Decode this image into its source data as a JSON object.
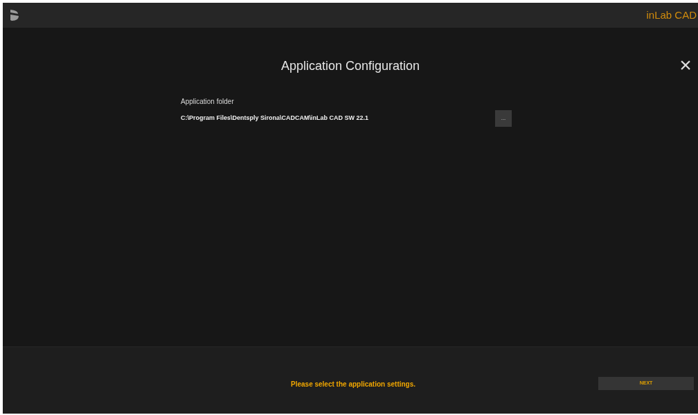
{
  "header": {
    "product": "inLab CAD"
  },
  "dialog": {
    "title": "Application Configuration",
    "close": "×",
    "field": {
      "label": "Application folder",
      "value": "C:\\Program Files\\Dentsply Sirona\\CADCAM\\inLab CAD SW 22.1",
      "browse": "..."
    }
  },
  "footer": {
    "message": "Please select the application settings.",
    "next": "NEXT"
  }
}
